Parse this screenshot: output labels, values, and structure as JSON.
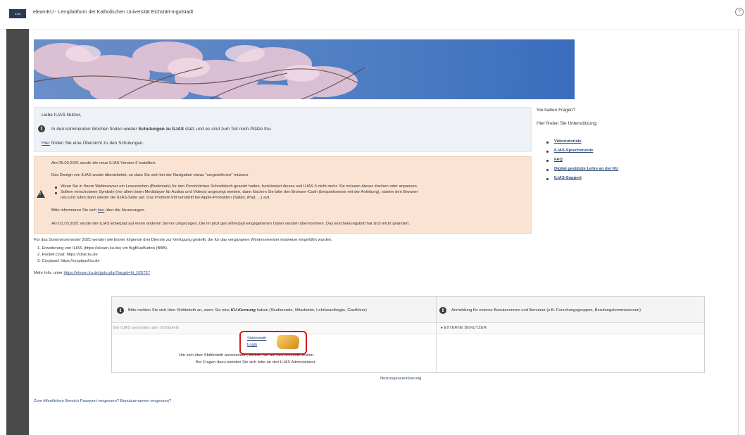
{
  "header": {
    "logo_text": "ILIAS",
    "title": "elearnKU - Lernplattform der Katholischen Universität Eichstätt-Ingolstadt",
    "help_icon": "help-icon"
  },
  "info_box": {
    "greeting": "Liebe ILIAS-Nutzer,",
    "line1_prefix": "In den kommenden Wochen finden wieder ",
    "line1_bold": "Schulungen zu ILIAS",
    "line1_suffix": " statt, und es sind zum Teil noch Plätze frei.",
    "line2_link": "Hier",
    "line2_rest": " finden Sie eine Übersicht zu den Schulungen."
  },
  "warning_box": {
    "line1": "Am 05.03.2021 wurde die neue ILIAS-Version 6 installiert.",
    "line2": "Das Design von ILIAS wurde überarbeitet, so dass Sie sich bei der Navigation etwas \"umgewöhnen\" müssen.",
    "bullet1": "Wenn Sie in Ihrem Webbrowser ein Lesezeichen (Bookmark) für den Persönlichen Schreibtisch gesetzt hatten, funktioniert dieses seit ILIAS 6 nicht mehr. Sie müssen dieses löschen oder anpassen.",
    "bullet2a": "Sollten verschobene Symbole (vor allem beim Medialayer für Audios und Videos) angezeigt werden, dann löschen Sie bitte den Browser-Cash (beispielsweise mit der Anleitung), starten den Browser",
    "bullet2b": "neu und rufen dann wieder die ILIAS-Seite auf. Das Problem tritt verstärkt bei Apple-Produkten (Safari, iPad, ...) auf.",
    "line3_prefix": "Bitte informieren Sie sich ",
    "line3_link": "hier",
    "line3_suffix": " über die Neuerungen.",
    "line4": "Am 01.03.2021 wurde der ILIAS Etherpad auf einen anderen Server umgezogen. Die im jetzt gen Etherpad eingegebenen Daten wurden übernommen. Das Erscheinungsbild hat sich leicht geändert."
  },
  "services": {
    "intro": "Für das Sommersemester 2021 werden wie bisher folgende drei Dienste zur Verfügung gestellt, die für das vergangene Wintersemester testweise eingeführt wurden.",
    "items": [
      "1. Erweiterung von ILIAS (https://elearn.ku.de) um BigBlueButton (BBB).",
      "2. Rocket.Chat: https://chat.ku.de",
      "3. Cryptpad: https://cryptpad.ku.de"
    ],
    "more_info_label": "Mehr Info: unter ",
    "more_info_link": "https://elearn.ku.de/goto.php?target=ht_625737"
  },
  "sidebar": {
    "question": "Sie haben Fragen?",
    "support": "Hier finden Sie Unterstützung:",
    "links": [
      "Videotutorials",
      "ILIAS-Sprechstunde",
      "FAQ",
      "Digital gestützte Lehre an der KU",
      "ILIAS-Support"
    ]
  },
  "login": {
    "left_header_prefix": "Bitte melden Sie sich über Shibboleth an, wenn Sie eine ",
    "left_header_bold": "KU-Kennung",
    "left_header_suffix": " haben (Studierende, Mitarbeiter, Lehrbeauftragte, Gasthörer)",
    "right_header": "Anmeldung für externe Benutzerinnen und Benutzer (z.B. Forschungsgruppen, Berufungskommissionen)",
    "left_tab": "Bei ILIAS anmelden über Shibboleth",
    "right_tab": "▸  EXTERNE BENUTZER",
    "shibboleth_label1": "Shibboleth",
    "shibboleth_label2": "Login",
    "hint1": "Um sich über Shibboleth anzumelden, klicken Sie auf den Anmelde-Button.",
    "hint2": "Bei Fragen dazu wenden Sie sich bitte an den ILIAS Administrator.",
    "terms": "Nutzungsvereinbarung"
  },
  "footer": {
    "public_area": "Zum öffentlichen Bereich",
    "forgot_password": "Passwort vergessen?",
    "forgot_username": "Benutzernamen vergessen?"
  },
  "colors": {
    "info_bg": "#eef1f6",
    "warning_bg": "#fbe3d4",
    "link": "#2e4b7c",
    "highlight": "#d11b1b"
  }
}
